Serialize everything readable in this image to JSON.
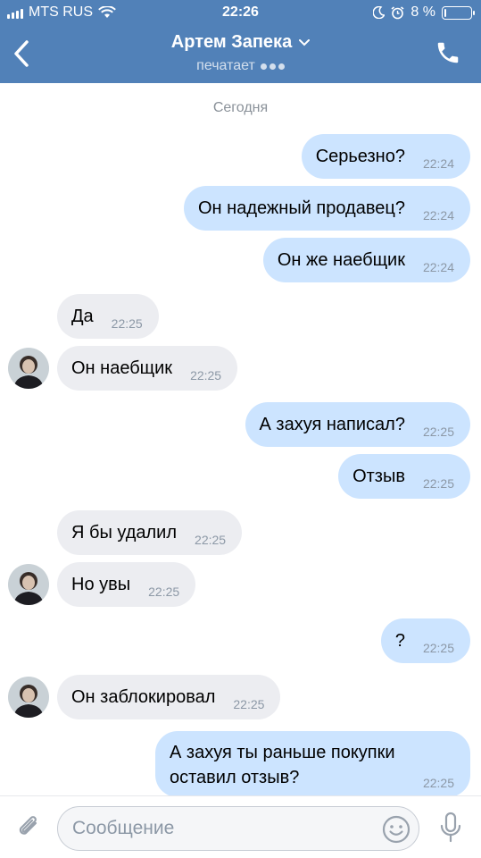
{
  "status_bar": {
    "carrier": "MTS RUS",
    "time": "22:26",
    "battery": "8 %",
    "battery_level": 0.08
  },
  "header": {
    "title": "Артем Запека",
    "subtitle": "печатает"
  },
  "chat": {
    "date_separator": "Сегодня",
    "messages": [
      {
        "dir": "out",
        "text": "Серьезно?",
        "time": "22:24"
      },
      {
        "dir": "out",
        "text": "Он надежный продавец?",
        "time": "22:24"
      },
      {
        "dir": "out",
        "text": "Он же наебщик",
        "time": "22:24"
      },
      {
        "dir": "in",
        "text": "Да",
        "time": "22:25"
      },
      {
        "dir": "in",
        "text": "Он наебщик",
        "time": "22:25"
      },
      {
        "dir": "out",
        "text": "А захуя написал?",
        "time": "22:25"
      },
      {
        "dir": "out",
        "text": "Отзыв",
        "time": "22:25"
      },
      {
        "dir": "in",
        "text": "Я бы удалил",
        "time": "22:25"
      },
      {
        "dir": "in",
        "text": "Но увы",
        "time": "22:25"
      },
      {
        "dir": "out",
        "text": "?",
        "time": "22:25"
      },
      {
        "dir": "in",
        "text": "Он заблокировал",
        "time": "22:25"
      },
      {
        "dir": "out",
        "text": "А захуя ты раньше покупки оставил отзыв?",
        "time": "22:25"
      }
    ]
  },
  "input": {
    "placeholder": "Сообщение"
  },
  "icons": {
    "back": "chevron-left-icon",
    "call": "phone-icon",
    "attach": "paperclip-icon",
    "emoji": "smiley-icon",
    "mic": "microphone-icon",
    "expand": "chevron-down-icon"
  },
  "colors": {
    "header_bg": "#5181b8",
    "outgoing_bubble": "#cce4ff",
    "incoming_bubble": "#ecedf1"
  }
}
